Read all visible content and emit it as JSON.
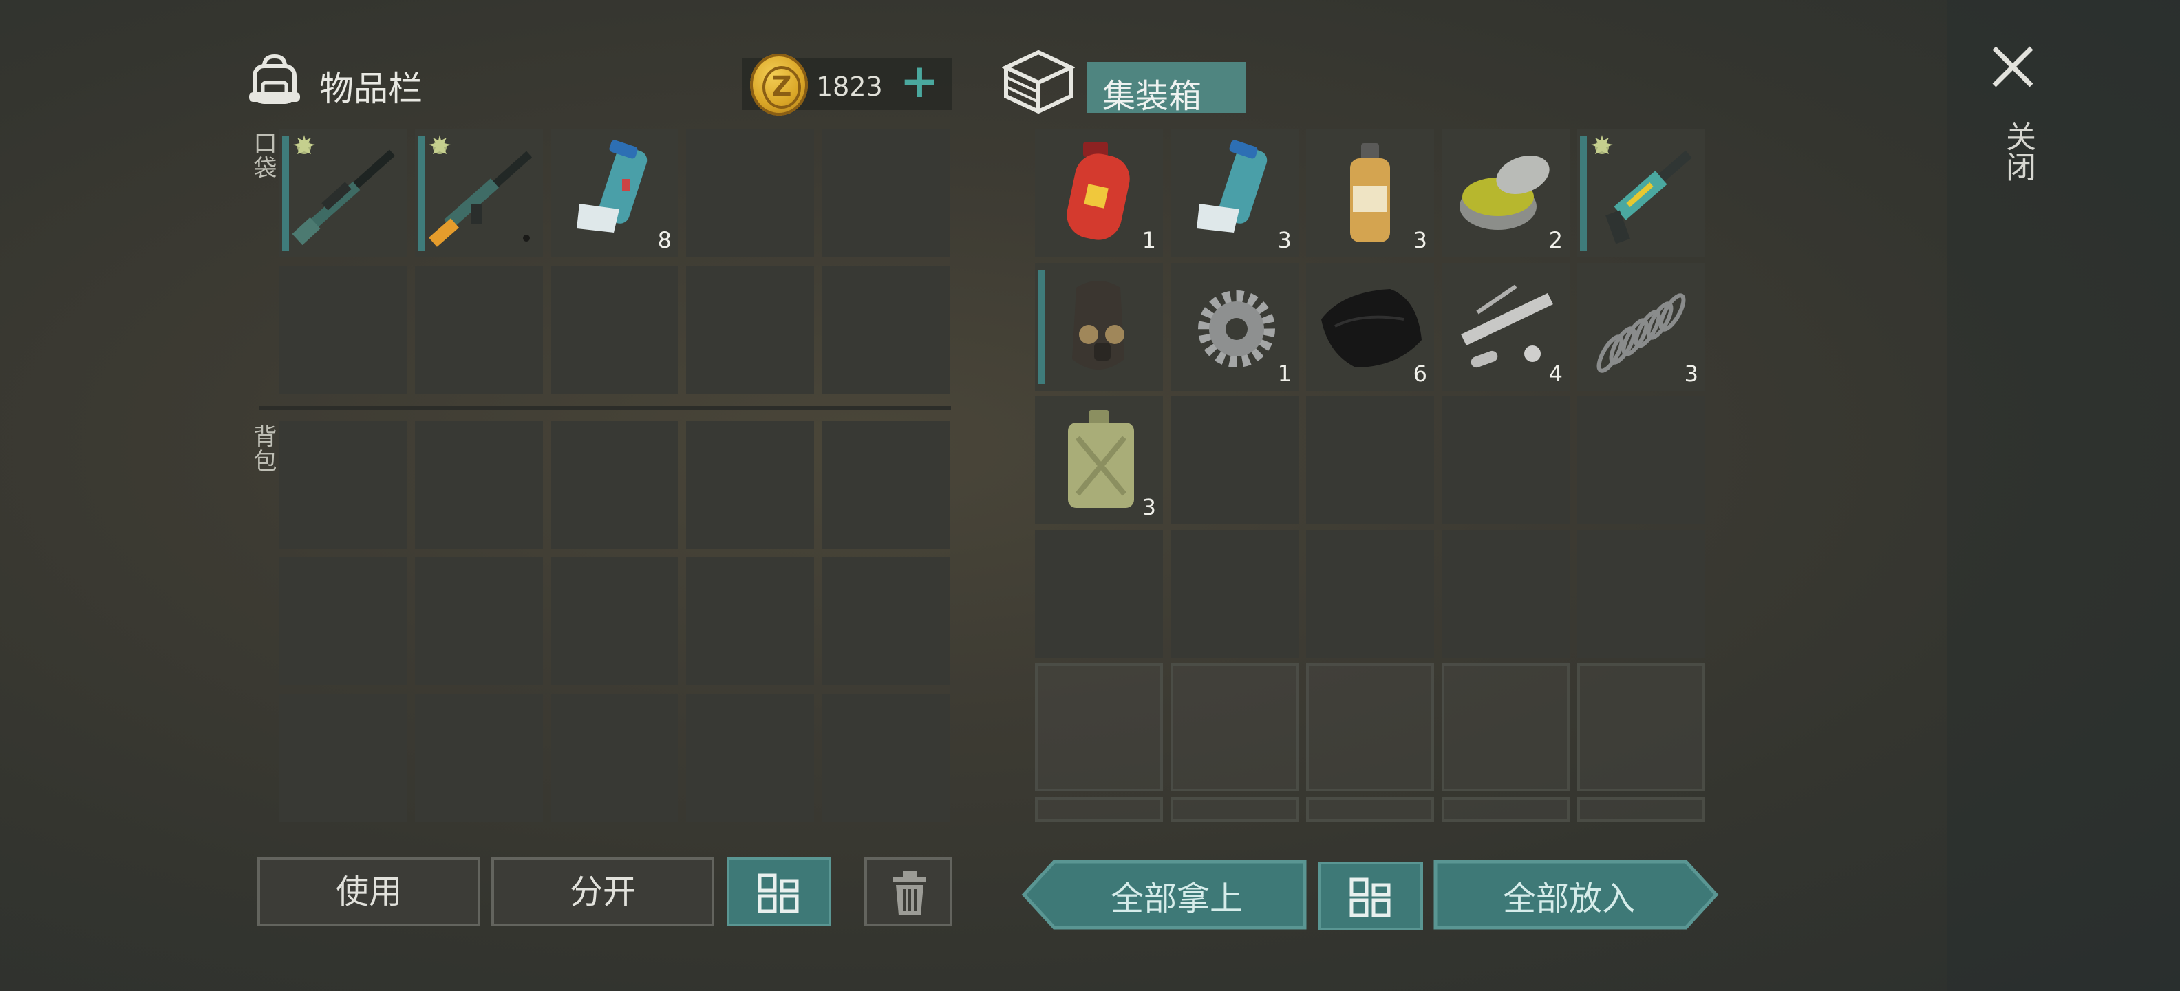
{
  "inventory": {
    "title": "物品栏",
    "pocket_label": "口袋",
    "backpack_label": "背包",
    "coins": "1823",
    "add_label": "+",
    "pocket_slots": [
      {
        "item": "sniper-rifle-icon",
        "count": "",
        "mod": true
      },
      {
        "item": "assault-rifle-icon",
        "count": "",
        "mod": true
      },
      {
        "item": "inhaler-icon",
        "count": "8",
        "mod": false
      }
    ]
  },
  "container": {
    "title": "集装箱",
    "slots": [
      {
        "item": "gas-cylinder-icon",
        "count": "1"
      },
      {
        "item": "inhaler-icon",
        "count": "3"
      },
      {
        "item": "pesticide-bottle-icon",
        "count": "3"
      },
      {
        "item": "ointment-jar-icon",
        "count": "2"
      },
      {
        "item": "blaster-gun-icon",
        "count": "",
        "mod": true
      },
      {
        "item": "gas-mask-hood-icon",
        "count": ""
      },
      {
        "item": "gear-icon",
        "count": "1"
      },
      {
        "item": "cloth-icon",
        "count": "6"
      },
      {
        "item": "pipe-parts-icon",
        "count": "4"
      },
      {
        "item": "spring-icon",
        "count": "3"
      },
      {
        "item": "jerrycan-icon",
        "count": "3"
      }
    ]
  },
  "buttons": {
    "use": "使用",
    "split": "分开",
    "take_all": "全部拿上",
    "put_all": "全部放入",
    "close": "关闭"
  },
  "colors": {
    "accent": "#3e7977",
    "coin": "#d9a526"
  }
}
